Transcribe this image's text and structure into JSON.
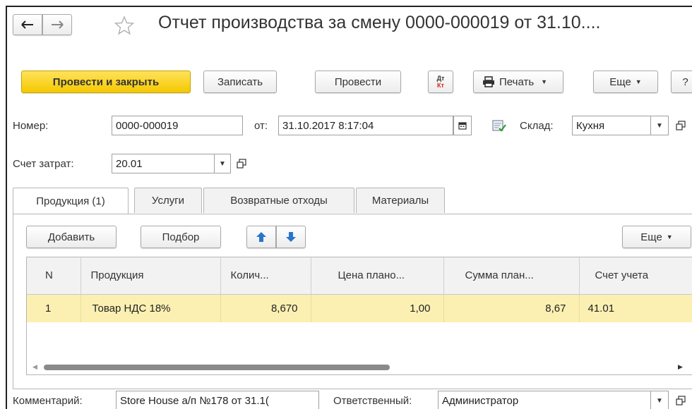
{
  "window": {
    "title": "Отчет производства за смену 0000-000019 от 31.10...."
  },
  "toolbar": {
    "post_close": "Провести и закрыть",
    "save": "Записать",
    "post": "Провести",
    "dtkt_top": "Дт",
    "dtkt_bottom": "Кт",
    "print": "Печать",
    "more": "Еще",
    "help": "?"
  },
  "form": {
    "number_label": "Номер:",
    "number_value": "0000-000019",
    "date_label": "от:",
    "date_value": "31.10.2017  8:17:04",
    "warehouse_label": "Склад:",
    "warehouse_value": "Кухня",
    "cost_account_label": "Счет затрат:",
    "cost_account_value": "20.01"
  },
  "tabs": [
    {
      "label": "Продукция (1)"
    },
    {
      "label": "Услуги"
    },
    {
      "label": "Возвратные отходы"
    },
    {
      "label": "Материалы"
    }
  ],
  "table_toolbar": {
    "add": "Добавить",
    "select": "Подбор",
    "more": "Еще"
  },
  "table": {
    "columns": [
      "N",
      "Продукция",
      "Колич...",
      "Цена плано...",
      "Сумма план...",
      "Счет учета"
    ],
    "rows": [
      [
        "1",
        "Товар НДС 18%",
        "8,670",
        "1,00",
        "8,67",
        "41.01"
      ]
    ]
  },
  "footer": {
    "comment_label": "Комментарий:",
    "comment_value": "Store House а/п №178 от 31.1(",
    "responsible_label": "Ответственный:",
    "responsible_value": "Администратор"
  },
  "colors": {
    "primary_button": "#f5c800",
    "selected_row": "#fbf0b2",
    "arrow_blue": "#2a74c9"
  }
}
